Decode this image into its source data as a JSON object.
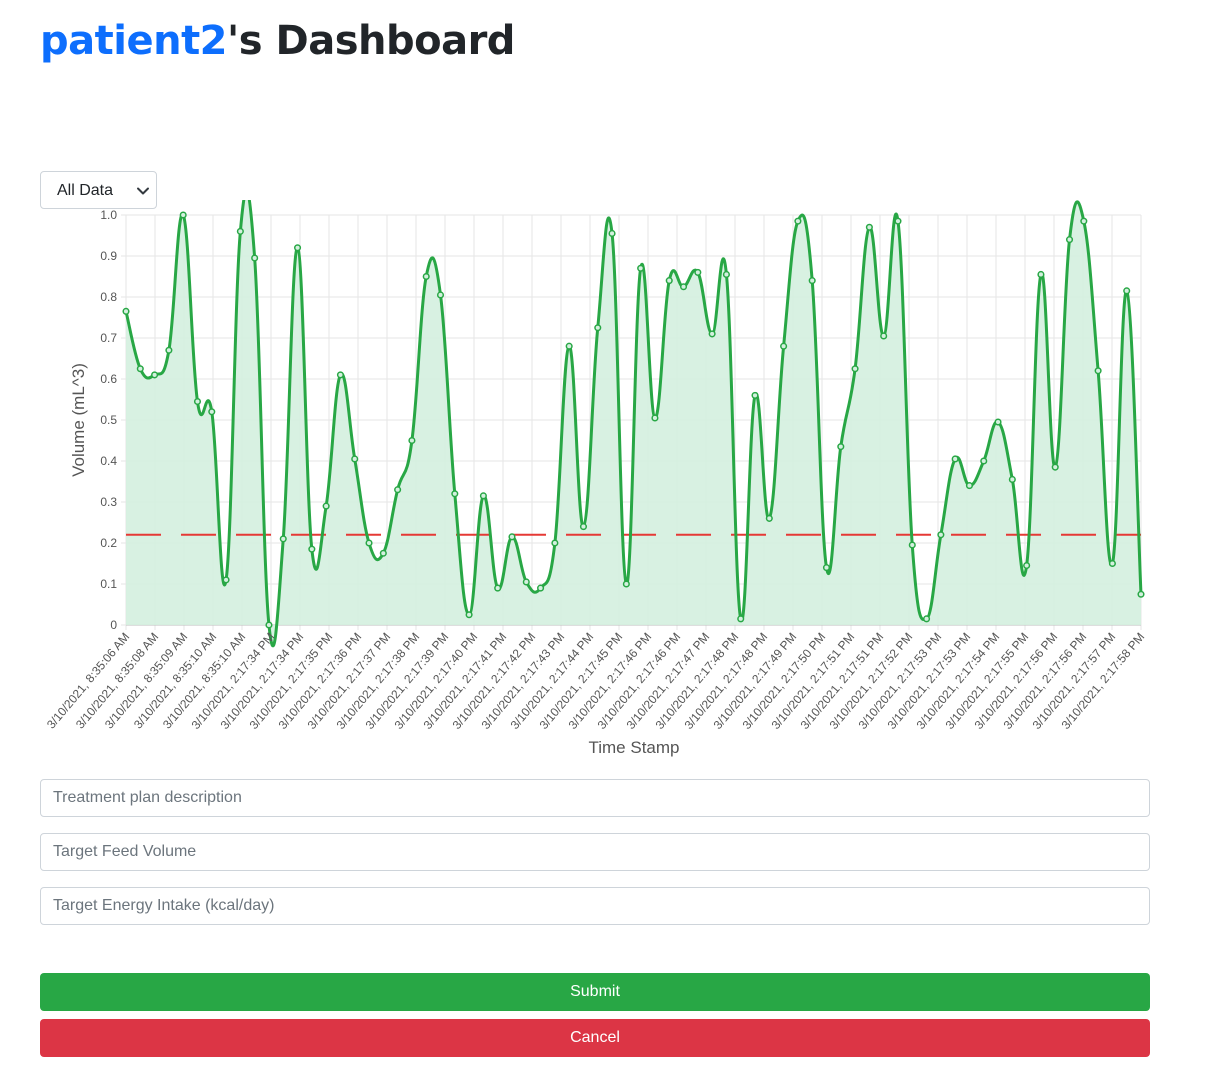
{
  "header": {
    "username": "patient2",
    "title_suffix": "'s Dashboard"
  },
  "filter": {
    "selected": "All Data"
  },
  "colors": {
    "line": "#28a745",
    "fill": "#d4f0df",
    "target": "#e53935",
    "link": "#0d6efd"
  },
  "chart_data": {
    "type": "line",
    "xlabel": "Time Stamp",
    "ylabel": "Volume (mL^3)",
    "ylim": [
      0,
      1
    ],
    "yticks": [
      "0",
      "0.1",
      "0.2",
      "0.3",
      "0.4",
      "0.5",
      "0.6",
      "0.7",
      "0.8",
      "0.9",
      "1.0"
    ],
    "grid": true,
    "target_line": 0.22,
    "x_tick_labels": [
      "3/10/2021, 8:35:06 AM",
      "3/10/2021, 8:35:08 AM",
      "3/10/2021, 8:35:09 AM",
      "3/10/2021, 8:35:10 AM",
      "3/10/2021, 8:35:10 AM",
      "3/10/2021, 2:17:34 PM",
      "3/10/2021, 2:17:34 PM",
      "3/10/2021, 2:17:35 PM",
      "3/10/2021, 2:17:36 PM",
      "3/10/2021, 2:17:37 PM",
      "3/10/2021, 2:17:38 PM",
      "3/10/2021, 2:17:39 PM",
      "3/10/2021, 2:17:40 PM",
      "3/10/2021, 2:17:41 PM",
      "3/10/2021, 2:17:42 PM",
      "3/10/2021, 2:17:43 PM",
      "3/10/2021, 2:17:44 PM",
      "3/10/2021, 2:17:45 PM",
      "3/10/2021, 2:17:46 PM",
      "3/10/2021, 2:17:46 PM",
      "3/10/2021, 2:17:47 PM",
      "3/10/2021, 2:17:48 PM",
      "3/10/2021, 2:17:48 PM",
      "3/10/2021, 2:17:49 PM",
      "3/10/2021, 2:17:50 PM",
      "3/10/2021, 2:17:51 PM",
      "3/10/2021, 2:17:51 PM",
      "3/10/2021, 2:17:52 PM",
      "3/10/2021, 2:17:53 PM",
      "3/10/2021, 2:17:53 PM",
      "3/10/2021, 2:17:54 PM",
      "3/10/2021, 2:17:55 PM",
      "3/10/2021, 2:17:56 PM",
      "3/10/2021, 2:17:56 PM",
      "3/10/2021, 2:17:57 PM",
      "3/10/2021, 2:17:58 PM"
    ],
    "values": [
      0.765,
      0.625,
      0.61,
      0.67,
      1.0,
      0.545,
      0.52,
      0.11,
      0.96,
      0.895,
      0.0,
      0.21,
      0.92,
      0.185,
      0.29,
      0.61,
      0.405,
      0.2,
      0.175,
      0.33,
      0.45,
      0.85,
      0.805,
      0.32,
      0.025,
      0.315,
      0.09,
      0.215,
      0.105,
      0.09,
      0.2,
      0.68,
      0.24,
      0.725,
      0.955,
      0.1,
      0.87,
      0.505,
      0.84,
      0.825,
      0.86,
      0.71,
      0.855,
      0.015,
      0.56,
      0.26,
      0.68,
      0.985,
      0.84,
      0.14,
      0.435,
      0.625,
      0.97,
      0.705,
      0.985,
      0.195,
      0.015,
      0.22,
      0.405,
      0.34,
      0.4,
      0.495,
      0.355,
      0.145,
      0.855,
      0.385,
      0.94,
      0.985,
      0.62,
      0.15,
      0.815,
      0.075
    ]
  },
  "form": {
    "treatment_placeholder": "Treatment plan description",
    "feed_volume_placeholder": "Target Feed Volume",
    "energy_intake_placeholder": "Target Energy Intake (kcal/day)",
    "submit_label": "Submit",
    "cancel_label": "Cancel"
  }
}
